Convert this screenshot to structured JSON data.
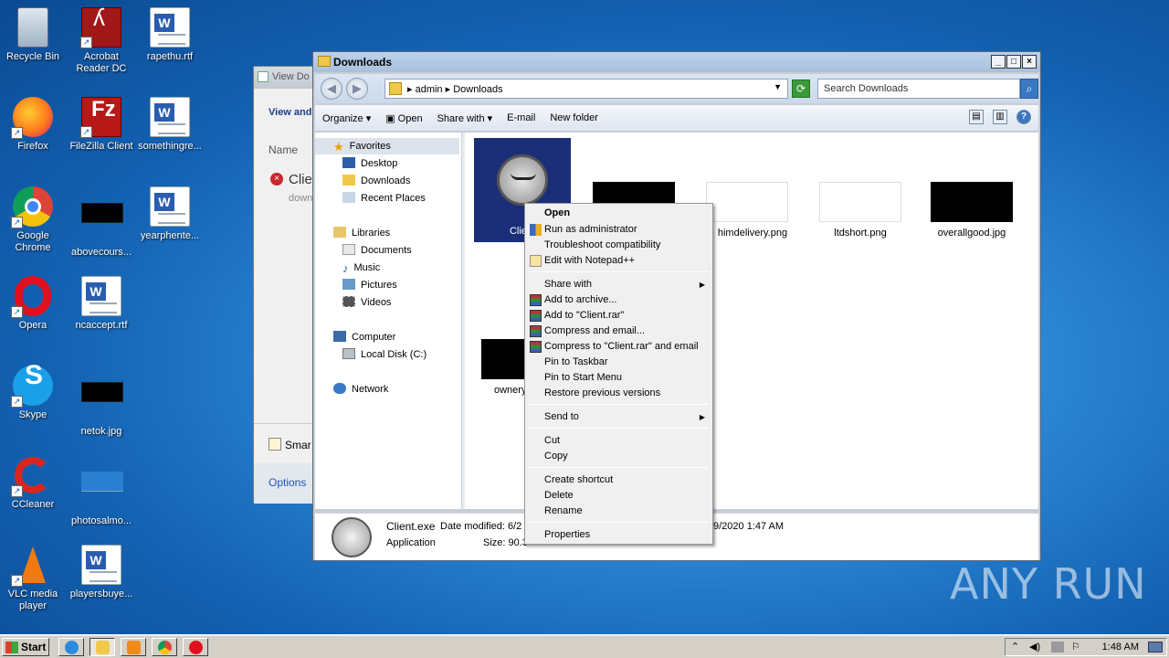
{
  "desktop": {
    "icons": [
      {
        "label": "Recycle Bin"
      },
      {
        "label": "Acrobat Reader DC"
      },
      {
        "label": "rapethu.rtf"
      },
      {
        "label": "Firefox"
      },
      {
        "label": "FileZilla Client"
      },
      {
        "label": "somethingre..."
      },
      {
        "label": "Google Chrome"
      },
      {
        "label": "abovecours..."
      },
      {
        "label": "yearphente..."
      },
      {
        "label": "Opera"
      },
      {
        "label": "ncaccept.rtf"
      },
      {
        "label": "Skype"
      },
      {
        "label": "netok.jpg"
      },
      {
        "label": "CCleaner"
      },
      {
        "label": "photosalmo..."
      },
      {
        "label": "VLC media player"
      },
      {
        "label": "playersbuye..."
      }
    ]
  },
  "bg_window": {
    "title": "View Do",
    "heading": "View and",
    "name_col": "Name",
    "item_name": "Clie",
    "item_sub": "down",
    "smart_label": "Smar",
    "options_label": "Options"
  },
  "explorer": {
    "title": "Downloads",
    "breadcrumb": [
      "admin",
      "Downloads"
    ],
    "search_placeholder": "Search Downloads",
    "toolbar": {
      "organize": "Organize",
      "open": "Open",
      "share_with": "Share with",
      "email": "E-mail",
      "new_folder": "New folder"
    },
    "nav": {
      "favorites": "Favorites",
      "desktop": "Desktop",
      "downloads": "Downloads",
      "recent_places": "Recent Places",
      "libraries": "Libraries",
      "documents": "Documents",
      "music": "Music",
      "pictures": "Pictures",
      "videos": "Videos",
      "computer": "Computer",
      "local_disk": "Local Disk (C:)",
      "network": "Network"
    },
    "files": [
      {
        "name": "Client"
      },
      {
        "name": "himdelivery.png"
      },
      {
        "name": "ltdshort.png"
      },
      {
        "name": "overallgood.jpg"
      },
      {
        "name": "ownery"
      }
    ],
    "details": {
      "name": "Client.exe",
      "date_label": "Date modified: 6/2",
      "date_tail": "9/2020 1:47 AM",
      "type": "Application",
      "size_label": "Size: 90.3"
    }
  },
  "context_menu": {
    "open": "Open",
    "run_as_admin": "Run as administrator",
    "troubleshoot": "Troubleshoot compatibility",
    "edit_notepad": "Edit with Notepad++",
    "share_with": "Share with",
    "add_archive": "Add to archive...",
    "add_client_rar": "Add to \"Client.rar\"",
    "compress_email": "Compress and email...",
    "compress_client_email": "Compress to \"Client.rar\" and email",
    "pin_taskbar": "Pin to Taskbar",
    "pin_start": "Pin to Start Menu",
    "restore_versions": "Restore previous versions",
    "send_to": "Send to",
    "cut": "Cut",
    "copy": "Copy",
    "create_shortcut": "Create shortcut",
    "delete": "Delete",
    "rename": "Rename",
    "properties": "Properties"
  },
  "taskbar": {
    "start": "Start",
    "clock": "1:48 AM"
  },
  "watermark": "ANY RUN"
}
